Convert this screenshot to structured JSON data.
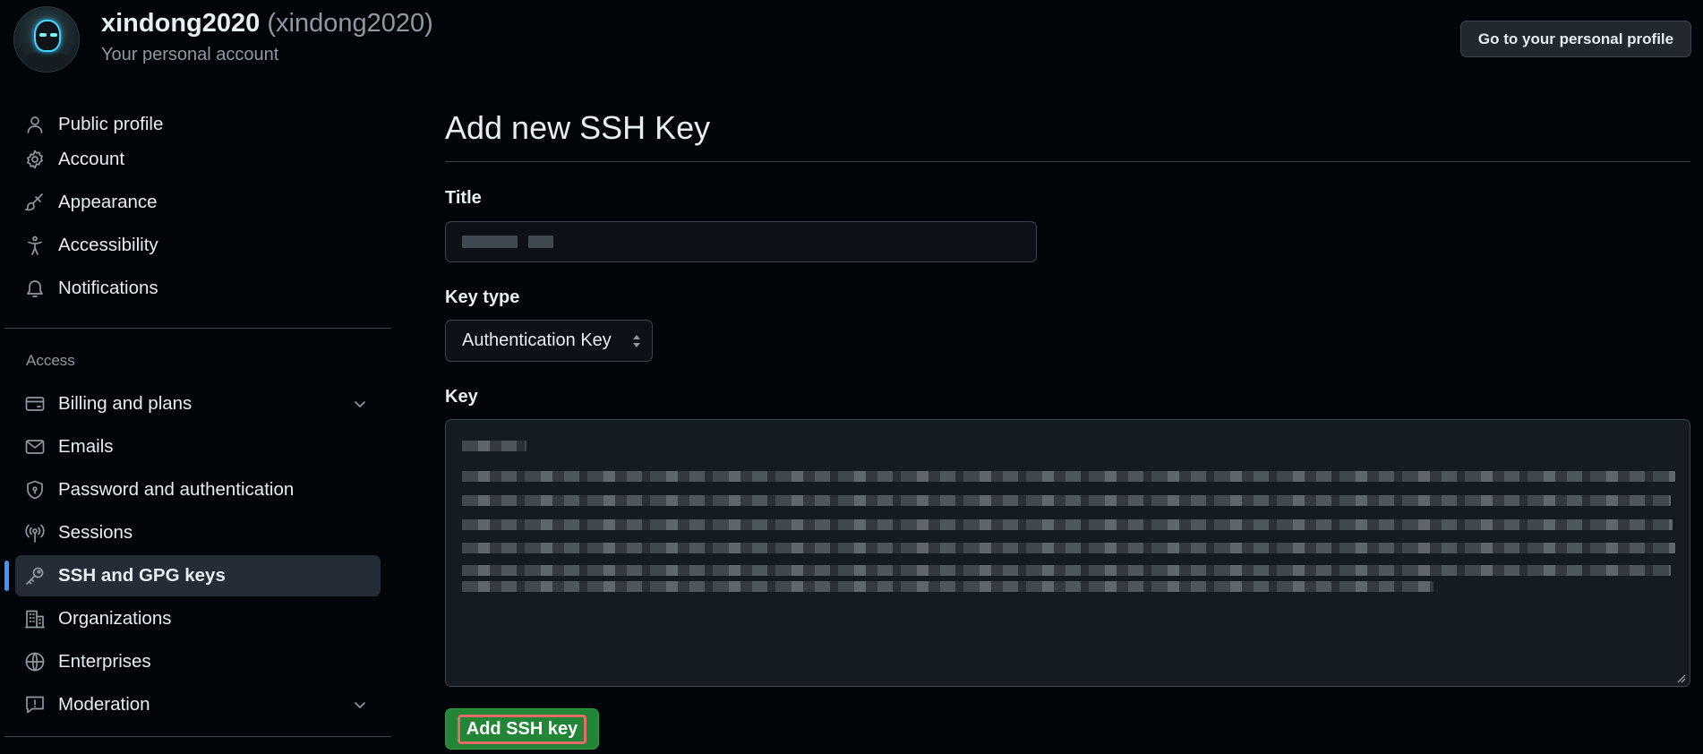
{
  "header": {
    "username": "xindong2020",
    "handle": "(xindong2020)",
    "subtitle": "Your personal account",
    "profile_button": "Go to your personal profile"
  },
  "sidebar": {
    "items": [
      {
        "label": "Public profile",
        "icon": "person-icon"
      },
      {
        "label": "Account",
        "icon": "gear-icon"
      },
      {
        "label": "Appearance",
        "icon": "paintbrush-icon"
      },
      {
        "label": "Accessibility",
        "icon": "accessibility-icon"
      },
      {
        "label": "Notifications",
        "icon": "bell-icon"
      }
    ],
    "access_heading": "Access",
    "access_items": [
      {
        "label": "Billing and plans",
        "icon": "credit-card-icon",
        "expandable": true
      },
      {
        "label": "Emails",
        "icon": "mail-icon"
      },
      {
        "label": "Password and authentication",
        "icon": "shield-lock-icon"
      },
      {
        "label": "Sessions",
        "icon": "broadcast-icon"
      },
      {
        "label": "SSH and GPG keys",
        "icon": "key-icon",
        "active": true
      },
      {
        "label": "Organizations",
        "icon": "organization-icon"
      },
      {
        "label": "Enterprises",
        "icon": "globe-icon"
      },
      {
        "label": "Moderation",
        "icon": "report-icon",
        "expandable": true
      }
    ]
  },
  "form": {
    "page_title": "Add new SSH Key",
    "title_label": "Title",
    "key_type_label": "Key type",
    "key_type_value": "Authentication Key",
    "key_label": "Key",
    "submit_label": "Add SSH key"
  },
  "colors": {
    "background": "#010409",
    "active_indicator": "#4493f8",
    "primary_button": "#238636",
    "highlight_outline": "#e56a6a"
  }
}
